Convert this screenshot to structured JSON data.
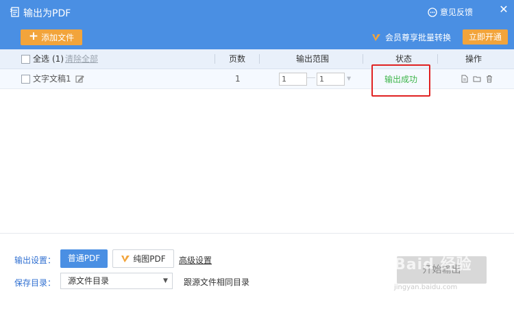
{
  "window": {
    "title": "输出为PDF",
    "feedback": "意见反馈",
    "close": "✕"
  },
  "toolbar": {
    "add_file_label": "添加文件",
    "vip_promo": "会员尊享批量转换",
    "open_now": "立即开通"
  },
  "table": {
    "select_all": "全选",
    "select_count": "(1)",
    "clear_all": "清除全部",
    "headers": {
      "pages": "页数",
      "range": "输出范围",
      "status": "状态",
      "actions": "操作"
    },
    "rows": [
      {
        "name": "文字文稿1",
        "pages": "1",
        "range_from": "1",
        "range_to": "1",
        "status": "输出成功"
      }
    ]
  },
  "bottom": {
    "output_settings_label": "输出设置：",
    "normal_pdf": "普通PDF",
    "pure_pdf": "纯图PDF",
    "advanced": "高级设置",
    "save_dir_label": "保存目录：",
    "save_dir_value": "源文件目录",
    "save_dir_desc": "跟源文件相同目录",
    "start_button": "开始输出"
  },
  "watermark": {
    "text": "Baid 经验",
    "sub": "jingyan.baidu.com"
  },
  "colors": {
    "titlebar": "#4a8fe3",
    "accent_orange": "#f2a43b",
    "success_green": "#3db54a",
    "highlight_red": "#e02020"
  }
}
